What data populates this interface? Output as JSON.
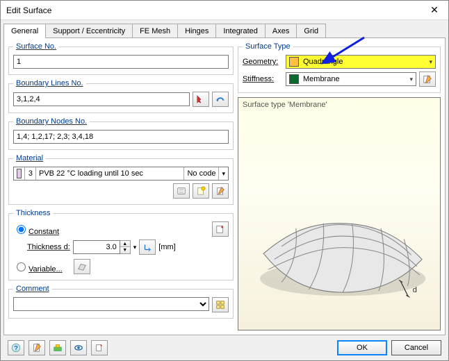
{
  "window": {
    "title": "Edit Surface"
  },
  "tabs": [
    "General",
    "Support / Eccentricity",
    "FE Mesh",
    "Hinges",
    "Integrated",
    "Axes",
    "Grid"
  ],
  "active_tab": 0,
  "left": {
    "surface_no": {
      "legend": "Surface No.",
      "value": "1"
    },
    "boundary_lines": {
      "legend": "Boundary Lines No.",
      "value": "3,1,2,4"
    },
    "boundary_nodes": {
      "legend": "Boundary Nodes No.",
      "value": "1,4; 1,2,17; 2,3; 3,4,18"
    },
    "material": {
      "legend": "Material",
      "index": "3",
      "name": "PVB 22 °C loading until 10 sec",
      "code": "No code"
    },
    "thickness": {
      "legend": "Thickness",
      "constant_label": "Constant",
      "variable_label": "Variable...",
      "d_label": "Thickness d:",
      "d_value": "3.0",
      "unit": "[mm]"
    },
    "comment": {
      "legend": "Comment",
      "value": ""
    }
  },
  "right": {
    "legend": "Surface Type",
    "geometry_label": "Geometry:",
    "geometry_value": "Quadrangle",
    "geometry_swatch": "#ffbf3f",
    "stiffness_label": "Stiffness:",
    "stiffness_value": "Membrane",
    "stiffness_swatch": "#0a6b2c",
    "preview_label": "Surface type 'Membrane'",
    "d_annot": "d"
  },
  "footer": {
    "ok": "OK",
    "cancel": "Cancel"
  }
}
